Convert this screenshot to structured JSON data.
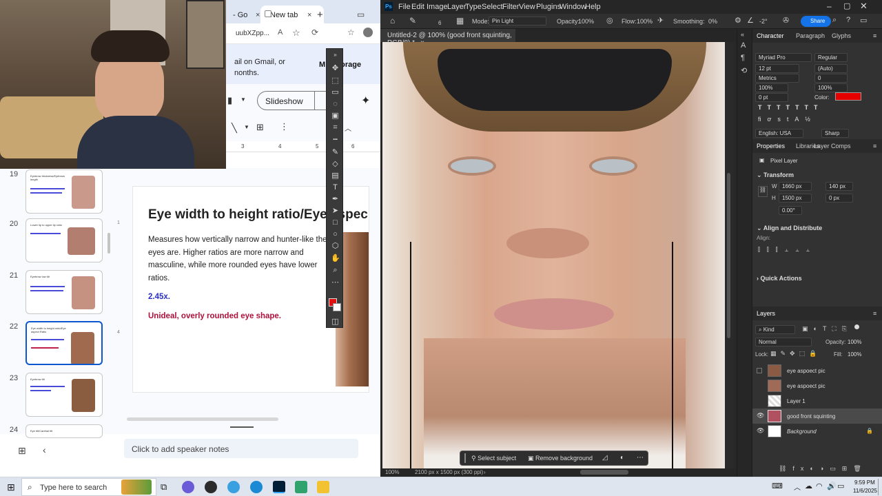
{
  "browser": {
    "tabs": [
      {
        "label": "- Go"
      },
      {
        "label": "New tab"
      }
    ],
    "new_tab_symbol": "+",
    "url_fragment": "uubXZpp...",
    "banner_left_line1": "ail on Gmail, or",
    "banner_left_line2": "nonths.",
    "banner_right": "M",
    "banner_right_link": "e storage",
    "slideshow_label": "Slideshow",
    "ruler_ticks": [
      "3",
      "4",
      "5",
      "6"
    ]
  },
  "slides": {
    "numbers": [
      "19",
      "20",
      "21",
      "22",
      "23",
      "24"
    ],
    "thumb_titles": [
      "Eyebrow thickness/Eyebrow length",
      "Lower lip to upper lip ratio",
      "Eyebrow low tilt",
      "Eye width to height ratio/Eye aspect Ratio",
      "Eyebrow tilt",
      "Eye tilt/Canthal tilt"
    ],
    "selected_index": 3,
    "current": {
      "title": "Eye width to height ratio/Eye aspec",
      "body": "Measures how vertically narrow and hunter-like the eyes are. Higher ratios are more narrow and masculine, while more rounded eyes have lower ratios.",
      "ratio": "2.45x.",
      "verdict": "Unideal, overly rounded eye shape."
    },
    "speaker_notes_placeholder": "Click to add speaker notes"
  },
  "photoshop": {
    "logo": "Ps",
    "menu": [
      "File",
      "Edit",
      "Image",
      "Layer",
      "Type",
      "Select",
      "Filter",
      "View",
      "Plugins",
      "Window",
      "Help"
    ],
    "options": {
      "mode_label": "Mode:",
      "mode_value": "Pin Light",
      "opacity_label": "Opacity:",
      "opacity_value": "100%",
      "flow_label": "Flow:",
      "flow_value": "100%",
      "smoothing_label": "Smoothing:",
      "smoothing_value": "0%",
      "angle_value": "-2°",
      "brush_size": "6",
      "share_label": "Share"
    },
    "doc_tab": "Untitled-2 @ 100% (good front squinting, RGB/8) *",
    "context_bar": {
      "select_subject": "Select subject",
      "remove_background": "Remove background"
    },
    "status": {
      "zoom": "100%",
      "doc_info": "2100 px x 1500 px (300 ppi)"
    },
    "character": {
      "tabs": [
        "Character",
        "Paragraph",
        "Glyphs"
      ],
      "font_family": "Myriad Pro",
      "font_style": "Regular",
      "size": "12 pt",
      "leading": "(Auto)",
      "kerning": "Metrics",
      "tracking": "0",
      "vscale": "100%",
      "hscale": "100%",
      "baseline": "0 pt",
      "color_label": "Color:",
      "color": "#e60000",
      "language": "English: USA",
      "antialias": "Sharp"
    },
    "properties": {
      "tabs": [
        "Properties",
        "Libraries",
        "Layer Comps"
      ],
      "kind": "Pixel Layer",
      "transform_label": "Transform",
      "w_label": "W",
      "w": "1660 px",
      "h_label": "H",
      "h": "1500 px",
      "x": "140 px",
      "y": "0 px",
      "angle": "0.00°",
      "align_title": "Align and Distribute",
      "align_label": "Align:",
      "quick_actions": "Quick Actions"
    },
    "layers": {
      "title": "Layers",
      "filter": "Kind",
      "blend": "Normal",
      "opacity_label": "Opacity:",
      "opacity": "100%",
      "lock_label": "Lock:",
      "fill_label": "Fill:",
      "fill": "100%",
      "items": [
        {
          "name": "eye aspoect pic",
          "visible": false
        },
        {
          "name": "eye aspoect pic",
          "visible": false
        },
        {
          "name": "Layer 1",
          "visible": false
        },
        {
          "name": "good front squinting",
          "visible": true,
          "selected": true
        },
        {
          "name": "Background",
          "visible": true,
          "locked": true
        }
      ]
    }
  },
  "taskbar": {
    "search_placeholder": "Type here to search",
    "time": "9:59 PM",
    "date": "11/6/2025"
  }
}
